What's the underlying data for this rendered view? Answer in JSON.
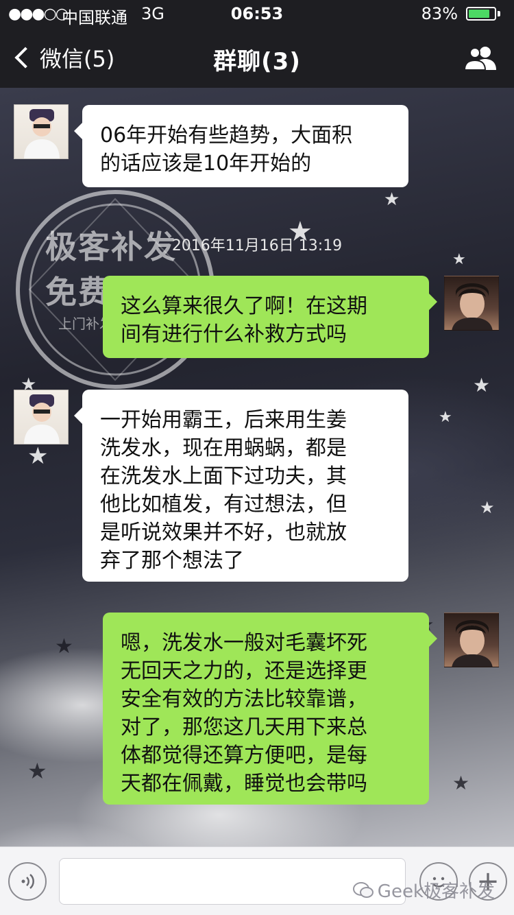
{
  "status_bar": {
    "signal": "●●●○○",
    "carrier": "中国联通",
    "network": "3G",
    "time": "06:53",
    "battery_percent": "83%",
    "battery_level": 0.83
  },
  "nav": {
    "back_label": "微信(5)",
    "title": "群聊(3)",
    "group_icon": "group-members-icon"
  },
  "messages": [
    {
      "side": "left",
      "text": "06年开始有些趋势，大面积\n的话应该是10年开始的"
    },
    {
      "side": "right",
      "text": "这么算来很久了啊！在这期\n间有进行什么补救方式吗"
    },
    {
      "side": "left",
      "text": "一开始用霸王，后来用生姜\n洗发水，现在用蜗蜗，都是\n在洗发水上面下过功夫，其\n他比如植发，有过想法，但\n是听说效果并不好，也就放\n弃了那个想法了"
    },
    {
      "side": "right",
      "text": "嗯，洗发水一般对毛囊坏死\n无回天之力的，还是选择更\n安全有效的方法比较靠谱，\n对了，那您这几天用下来总\n体都觉得还算方便吧，是每\n天都在佩戴，睡觉也会带吗"
    }
  ],
  "timestamp": "2016年11月16日 13:19",
  "watermark": {
    "line1": "极客补发",
    "line2": "免费试用",
    "line3": "上门补发快乐到家"
  },
  "input_bar": {
    "voice_icon": "voice-icon",
    "emoji_icon": "emoji-icon",
    "plus_icon": "plus-icon",
    "brand": "Geek极客补发"
  },
  "colors": {
    "bar_bg": "#1e1e22",
    "bubble_self": "#9fe658",
    "bubble_other": "#ffffff",
    "battery": "#4cd964"
  }
}
